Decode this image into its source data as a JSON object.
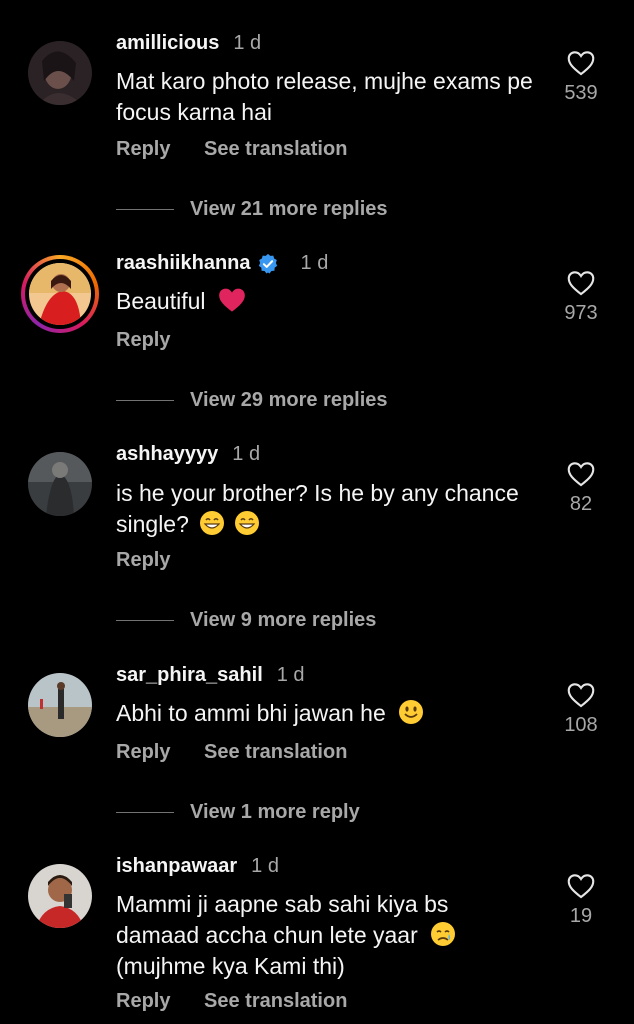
{
  "comments": [
    {
      "username": "amillicious",
      "time": "1 d",
      "text": "Mat karo photo release, mujhe exams pe focus karna hai",
      "likes": "539",
      "reply_label": "Reply",
      "see_translation_label": "See translation",
      "view_replies": "View 21 more replies"
    },
    {
      "username": "raashiikhanna",
      "time": "1 d",
      "text": "Beautiful",
      "likes": "973",
      "reply_label": "Reply",
      "view_replies": "View 29 more replies"
    },
    {
      "username": "ashhayyyy",
      "time": "1 d",
      "text_line1": "is he your brother? Is he by any chance",
      "text_line2": "single?",
      "likes": "82",
      "reply_label": "Reply",
      "view_replies": "View 9 more replies"
    },
    {
      "username": "sar_phira_sahil",
      "time": "1 d",
      "text": "Abhi to ammi bhi jawan he",
      "likes": "108",
      "reply_label": "Reply",
      "see_translation_label": "See translation",
      "view_replies": "View 1 more reply"
    },
    {
      "username": "ishanpawaar",
      "time": "1 d",
      "text_line1": "Mammi ji aapne sab sahi kiya bs",
      "text_line2": "damaad accha chun lete yaar",
      "text_line3": "(mujhme kya Kami thi)",
      "likes": "19",
      "reply_label": "Reply",
      "see_translation_label": "See translation"
    }
  ],
  "colors": {
    "background": "#000000",
    "primary_text": "#f5f5f5",
    "secondary_text": "#a8a8a8",
    "verified_blue": "#3897f0",
    "heart_red": "#e0245e"
  }
}
